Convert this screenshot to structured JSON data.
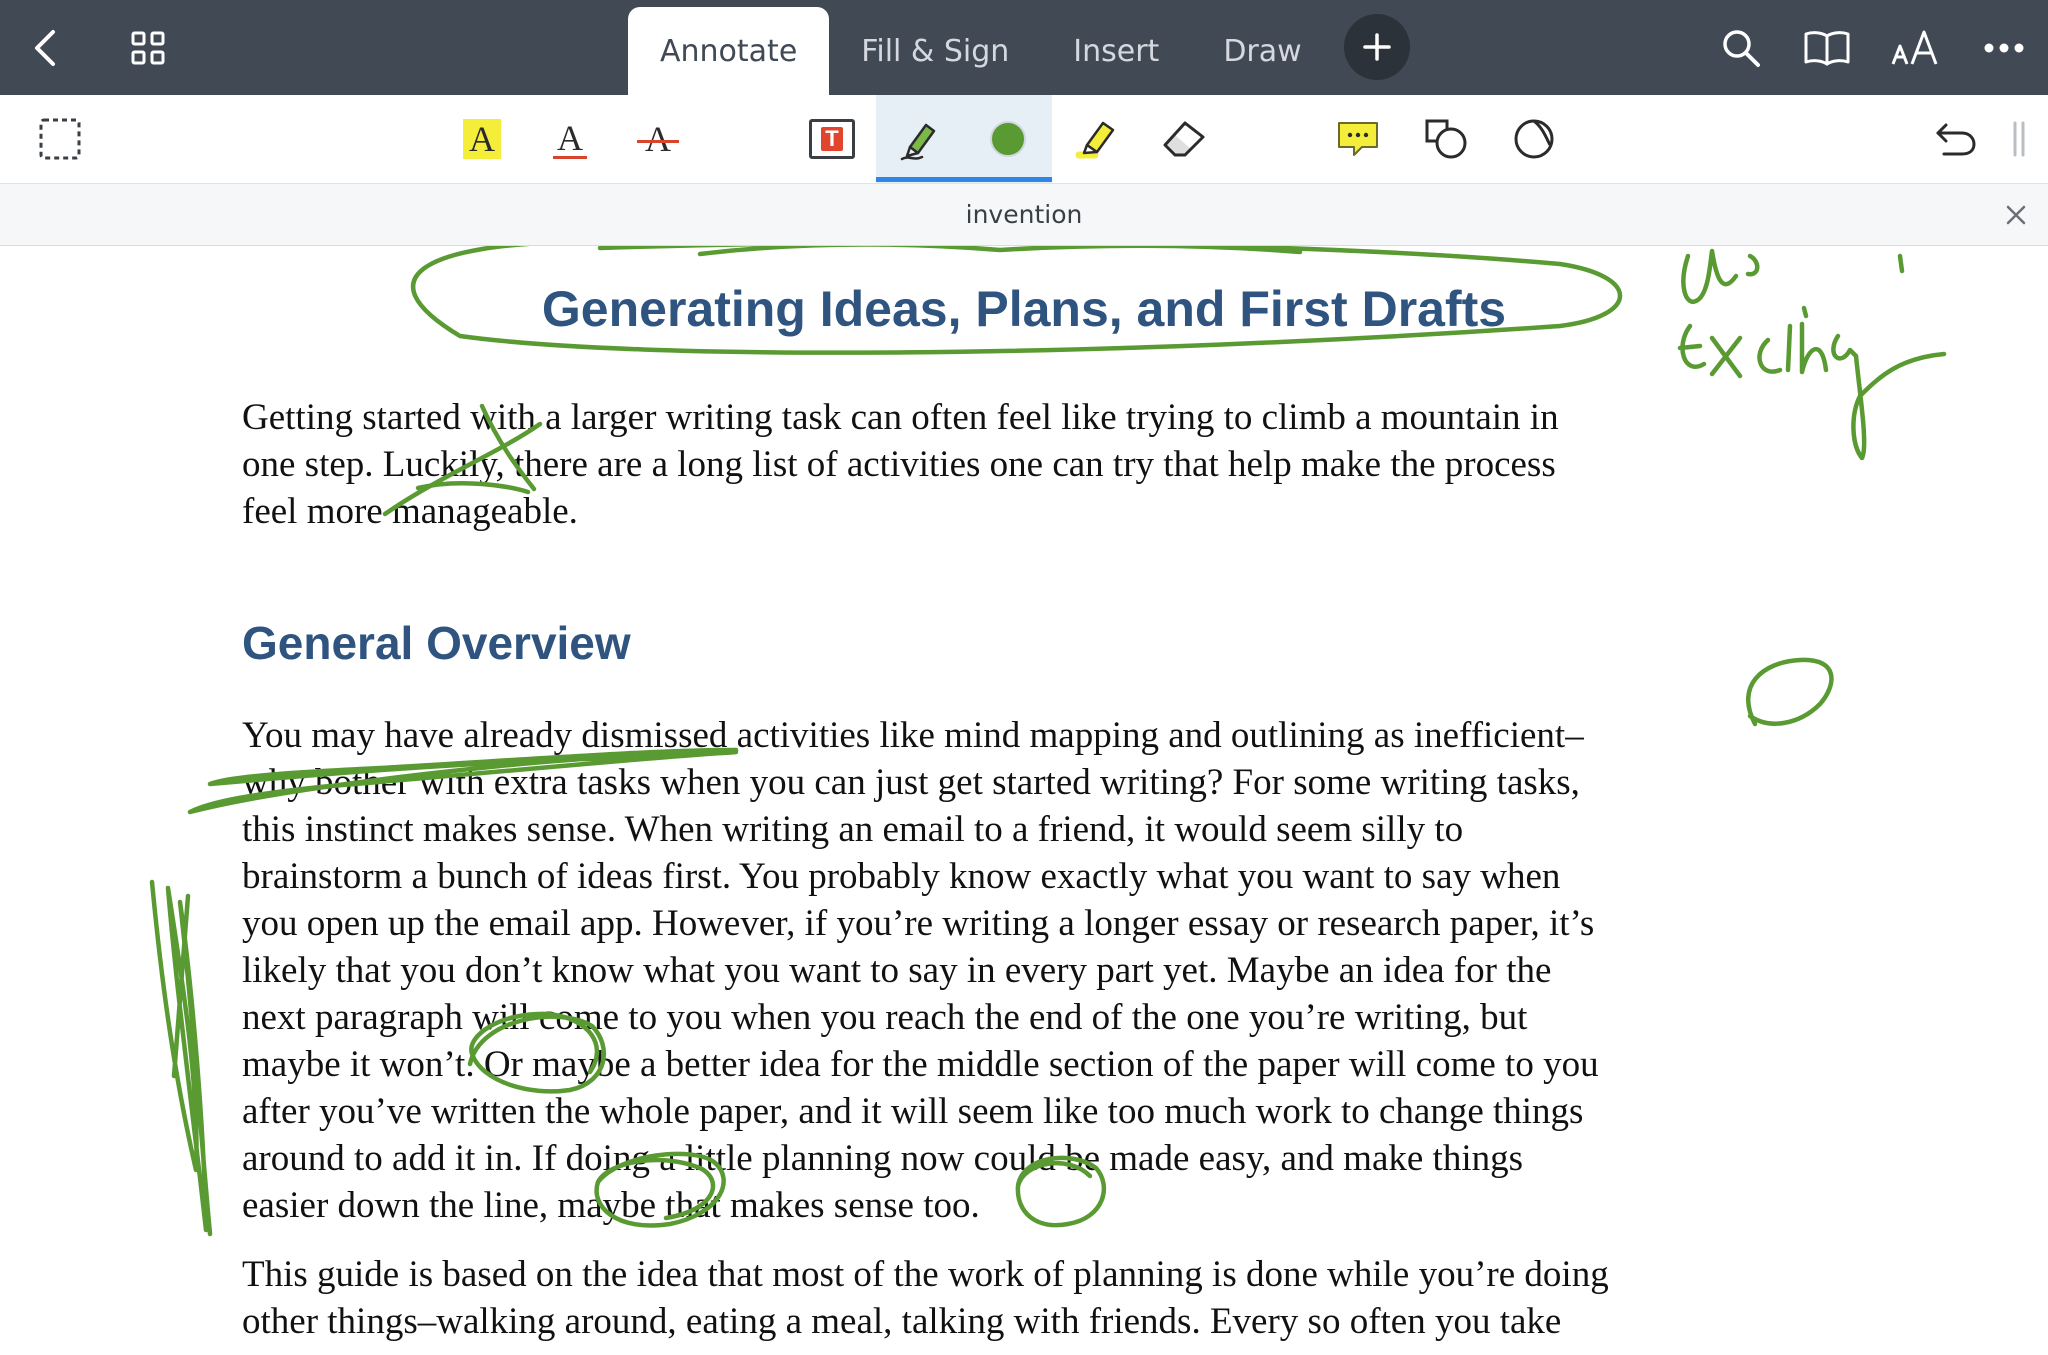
{
  "nav": {
    "tabs": [
      {
        "label": "Annotate",
        "active": true
      },
      {
        "label": "Fill & Sign",
        "active": false
      },
      {
        "label": "Insert",
        "active": false
      },
      {
        "label": "Draw",
        "active": false
      }
    ],
    "icons": [
      "back-icon",
      "grid-icon",
      "add-icon",
      "search-icon",
      "book-icon",
      "text-size-icon",
      "more-icon"
    ],
    "colors": {
      "bar": "#414955",
      "active_tab": "#ffffff"
    }
  },
  "toolbar": {
    "highlight_letter": "A",
    "underline_letter": "A",
    "strike_letter": "A",
    "textbox_letter": "T",
    "icons": [
      "select-icon",
      "highlight-text-icon",
      "underline-text-icon",
      "strikethrough-text-icon",
      "textbox-icon",
      "pen-icon",
      "color-swatch-icon",
      "highlighter-icon",
      "eraser-icon",
      "comment-icon",
      "shapes-icon",
      "lasso-icon",
      "undo-icon",
      "drag-handle-icon"
    ],
    "selected_tool": "pen",
    "pen_color": "#5a9a32",
    "accent": "#2f86e4"
  },
  "document": {
    "title": "invention",
    "heading": "Generating Ideas, Plans, and First Drafts",
    "intro_lines": [
      "Getting started with a larger writing task can often feel like trying to climb a mountain in",
      "one step. Luckily, there are a long list of activities one can try that help make the process",
      "feel more manageable."
    ],
    "section_heading": "General Overview",
    "body_lines": [
      "You may have already dismissed activities like mind mapping and outlining as inefficient–",
      "why bother with extra tasks when you can just get started writing? For some writing tasks,",
      "this instinct makes sense. When writing an email to a friend, it would seem silly to",
      "brainstorm a bunch of ideas first. You probably know exactly what you want to say when",
      "you open up the email app. However, if you’re writing a longer essay or research paper, it’s",
      "likely that you don’t know what you want to say in every part yet. Maybe an idea for the",
      "next paragraph will come to you when you reach the end of the one you’re writing, but",
      "maybe it won’t. Or maybe a better idea for the middle section of the paper will come to you",
      "after you’ve written the whole paper, and it will seem like too much work to change things",
      "around to add it in. If doing a little planning now could be made easy, and make things",
      "easier down the line, maybe that makes sense too."
    ],
    "next_lines": [
      "This guide is based on the idea that most of the work of planning is done while you’re doing",
      "other things–walking around, eating a meal, talking with friends. Every so often you take"
    ],
    "heading_color": "#2f5480",
    "ink_color": "#5a9a32"
  }
}
